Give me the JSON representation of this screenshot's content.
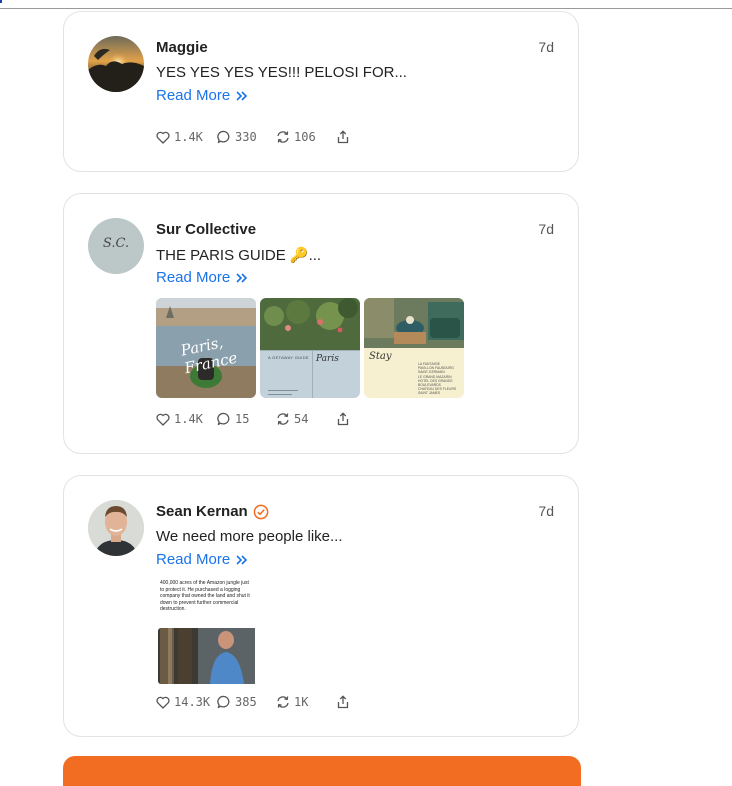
{
  "posts": [
    {
      "author": "Maggie",
      "age": "7d",
      "text": "YES YES YES YES!!! PELOSI FOR...",
      "read_more": "Read More",
      "likes": "1.4K",
      "comments": "330",
      "reposts": "106",
      "verified": false
    },
    {
      "author": "Sur Collective",
      "avatar_text": "S.C.",
      "age": "7d",
      "text": "THE PARIS GUIDE 🔑...",
      "read_more": "Read More",
      "likes": "1.4K",
      "comments": "15",
      "reposts": "54",
      "images": [
        {
          "caption": "Paris, France"
        },
        {
          "caption_small": "A GETAWAY GUIDE",
          "caption": "Paris"
        },
        {
          "caption": "Stay",
          "list": [
            "LA FANTAISIE",
            "PAVILLON FAUBOURG",
            "SAINT-GERMAIN",
            "LE GRAND MAZARIN",
            "HOTEL DES GRANDS",
            "BOULEVARDS",
            "CHATEAU DES FLEURS",
            "SAINT JAMES"
          ]
        }
      ]
    },
    {
      "author": "Sean Kernan",
      "age": "7d",
      "text": "We need more people like...",
      "read_more": "Read More",
      "likes": "14.3K",
      "comments": "385",
      "reposts": "1K",
      "verified": true,
      "image_text": "400,000 acres of the Amazon jungle just to protect it. He purchased a logging company that owned the land and shut it down to prevent further commercial destruction."
    }
  ],
  "colors": {
    "accent": "#1a73e8",
    "verified": "#f26d21",
    "bottom_bar": "#f26d21"
  }
}
